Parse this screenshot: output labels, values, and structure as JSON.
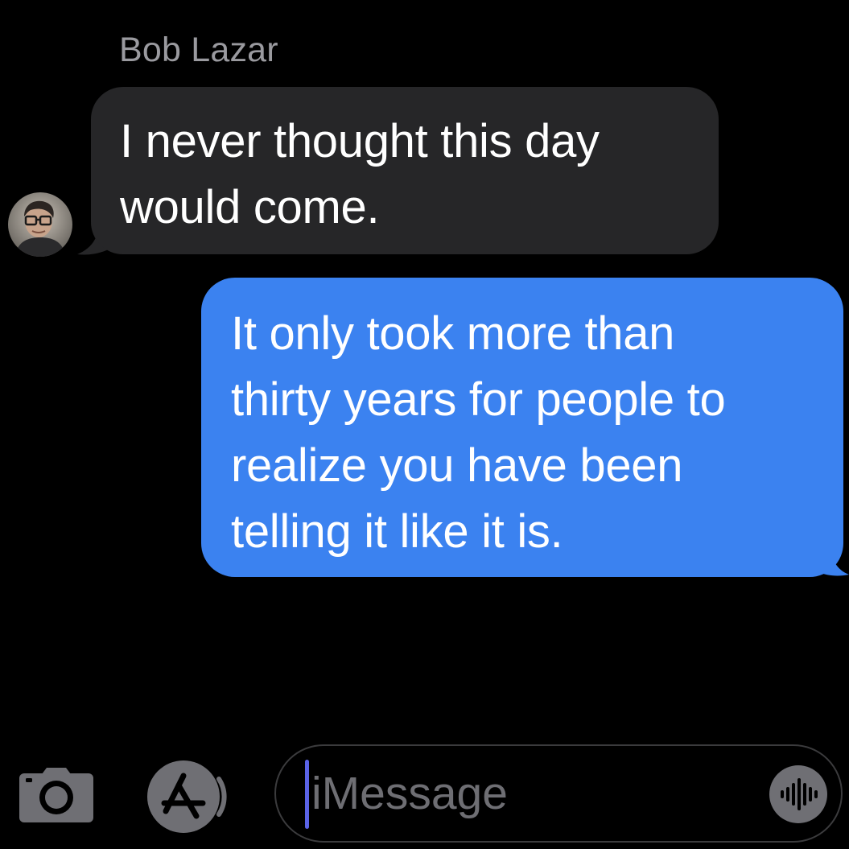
{
  "conversation": {
    "sender_name": "Bob Lazar",
    "messages": [
      {
        "direction": "incoming",
        "text": "I never thought this day\nwould come."
      },
      {
        "direction": "outgoing",
        "text": "It only took more than\nthirty years for people to\nrealize you have been\ntelling it like it is."
      }
    ]
  },
  "avatar": {
    "icon": "contact-avatar"
  },
  "composer": {
    "placeholder": "iMessage",
    "camera_icon": "camera-icon",
    "apps_icon": "app-store-icon",
    "audio_icon": "audio-waveform-icon"
  },
  "colors": {
    "background": "#000000",
    "incoming_bubble": "#262628",
    "outgoing_bubble": "#3b82f0",
    "sender_name": "#9a9a9f",
    "cursor": "#5a63e6",
    "icon_gray": "#6f6f74"
  }
}
